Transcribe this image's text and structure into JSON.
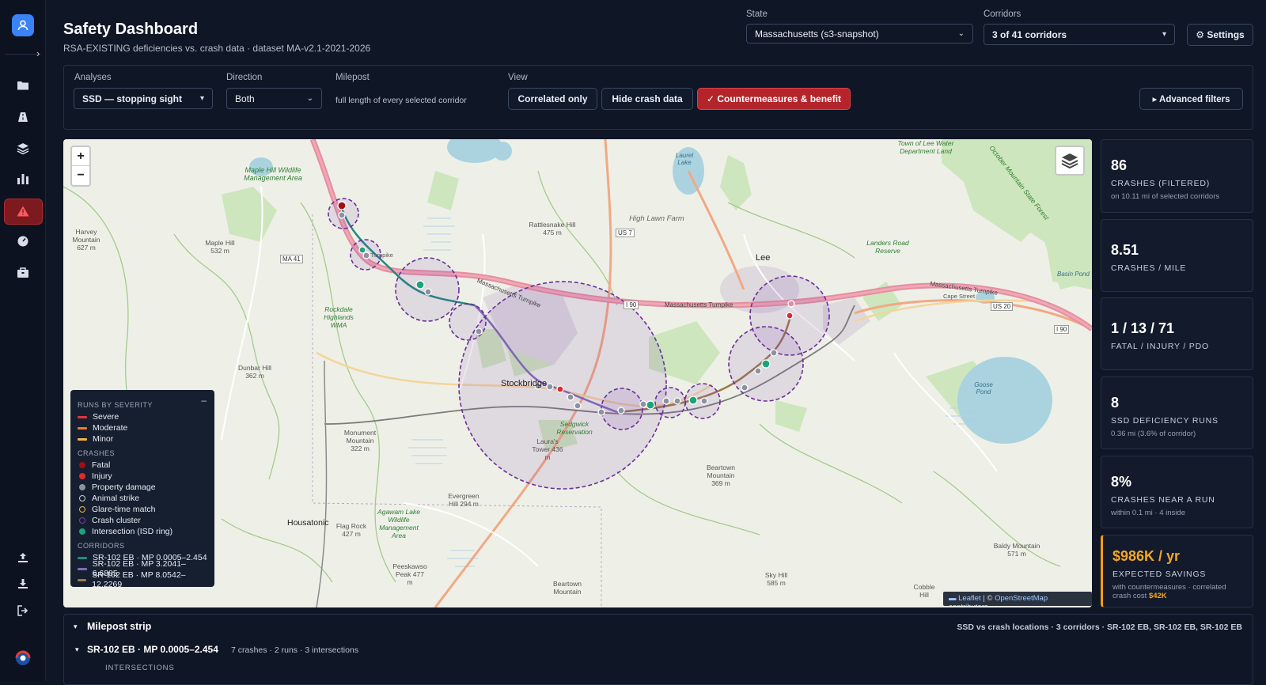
{
  "header": {
    "title": "Safety Dashboard",
    "subtitle": "RSA-EXISTING deficiencies vs. crash data · dataset MA-v2.1-2021-2026",
    "state_label": "State",
    "state_value": "Massachusetts (s3-snapshot)",
    "corridors_label": "Corridors",
    "corridors_value": "3 of 41 corridors",
    "settings_label": "⚙ Settings"
  },
  "filters": {
    "analyses_label": "Analyses",
    "analyses_value": "SSD — stopping sight",
    "direction_label": "Direction",
    "direction_value": "Both",
    "milepost_label": "Milepost",
    "milepost_value": "full length of every selected corridor",
    "view_label": "View",
    "view_buttons": [
      "Correlated only",
      "Hide crash data",
      "✓ Countermeasures & benefit"
    ],
    "advanced_label": "▸  Advanced filters"
  },
  "map": {
    "zoom_in": "+",
    "zoom_out": "−",
    "place_labels": {
      "stockbridge": "Stockbridge",
      "lee": "Lee",
      "housatonic": "Housatonic",
      "mass_pike_1": "Massachusetts Turnpike",
      "mass_pike_2": "Massachusetts Turnpike",
      "mass_pike_3": "Massachusetts Turnpike",
      "i90_1": "I 90",
      "i90_2": "I 90",
      "us7": "US 7",
      "us20": "US 20",
      "ma41": "MA 41",
      "maple_hill_wma": "Maple Hill Wildlife Management Area",
      "rattlesnake": "Rattlesnake Hill 475 m",
      "high_lawn": "High Lawn Farm",
      "landers": "Landers Road Reserve",
      "rockdale": "Rockdale Highlands WMA",
      "dunbar": "Dunbar Hill 362 m",
      "harvey": "Harvey Mountain 627 m",
      "maple_hill": "Maple Hill 532 m",
      "monument": "Monument Mountain 322 m",
      "laurel_tower": "Laura's Tower 436 m",
      "sedgwick": "Sedgwick Reservation",
      "agawam": "Agawam Lake Wildlife Management Area",
      "evergreen": "Evergreen Hill 294 m",
      "flag_rock": "Flag Rock 427 m",
      "peeskawso": "Peeskawso Peak 477 m",
      "beartown_1": "Beartown Mountain 369 m",
      "beartown_2": "Beartown Mountain",
      "sky_hill": "Sky Hill 585 m",
      "baldy": "Baldy Mountain 571 m",
      "cobble": "Cobble Hill",
      "basin_pond": "Basin Pond",
      "goose_pond": "Goose Pond",
      "laurel_lake": "Laurel Lake",
      "lee_water": "Town of Lee Water Department Land",
      "october_mtn": "October Mountain State Forest",
      "cape_street": "Cape Street",
      "turnpike": "Turnpike"
    },
    "attribution": {
      "leaflet": "▬ Leaflet",
      "sep": " | © ",
      "osm": "OpenStreetMap",
      "contrib": " contributors"
    }
  },
  "legend": {
    "runs_header": "RUNS BY SEVERITY",
    "collapse": "–",
    "runs": [
      {
        "label": "Severe",
        "color": "#e0353a"
      },
      {
        "label": "Moderate",
        "color": "#f07a2a"
      },
      {
        "label": "Minor",
        "color": "#f5b441"
      }
    ],
    "crashes_header": "CRASHES",
    "crashes": [
      {
        "label": "Fatal",
        "color": "#a10e15",
        "kind": "dot"
      },
      {
        "label": "Injury",
        "color": "#e02a2f",
        "kind": "dot"
      },
      {
        "label": "Property damage",
        "color": "#8c939e",
        "kind": "dot"
      },
      {
        "label": "Animal strike",
        "color": "#c9cfd8",
        "kind": "ring"
      },
      {
        "label": "Glare-time match",
        "color": "#f5b441",
        "kind": "ring"
      },
      {
        "label": "Crash cluster",
        "color": "#7b3fa8",
        "kind": "ring"
      },
      {
        "label": "Intersection (ISD ring)",
        "color": "#1aa57a",
        "kind": "dot"
      }
    ],
    "corridors_header": "CORRIDORS",
    "corridors": [
      {
        "label": "SR-102 EB · MP 0.0005–2.454",
        "color": "#1f8a80"
      },
      {
        "label": "SR-102 EB · MP 3.2041–6.6885",
        "color": "#7f6bb8"
      },
      {
        "label": "SR-102 EB · MP 8.0542–12.2269",
        "color": "#9b7a4a"
      }
    ]
  },
  "stats": [
    {
      "value": "86",
      "label": "CRASHES (FILTERED)",
      "sub": "on 10.11 mi of selected corridors"
    },
    {
      "value": "8.51",
      "label": "CRASHES / MILE",
      "sub": ""
    },
    {
      "value": "1 / 13 / 71",
      "label": "FATAL / INJURY / PDO",
      "sub": ""
    },
    {
      "value": "8",
      "label": "SSD DEFICIENCY RUNS",
      "sub": "0.36 mi (3.6% of corridor)"
    },
    {
      "value": "8%",
      "label": "CRASHES NEAR A RUN",
      "sub": "within 0.1 mi · 4 inside"
    },
    {
      "value": "$986K / yr",
      "label": "EXPECTED SAVINGS",
      "sub": "with countermeasures · correlated crash cost",
      "amount": "$42K"
    }
  ],
  "milepost": {
    "strip_title": "Milepost strip",
    "strip_summary": "SSD vs crash locations · 3 corridors · SR-102 EB, SR-102 EB, SR-102 EB",
    "corridor_title": "SR-102 EB · MP 0.0005–2.454",
    "corridor_meta": "7 crashes · 2 runs · 3 intersections",
    "intersections_label": "INTERSECTIONS"
  }
}
